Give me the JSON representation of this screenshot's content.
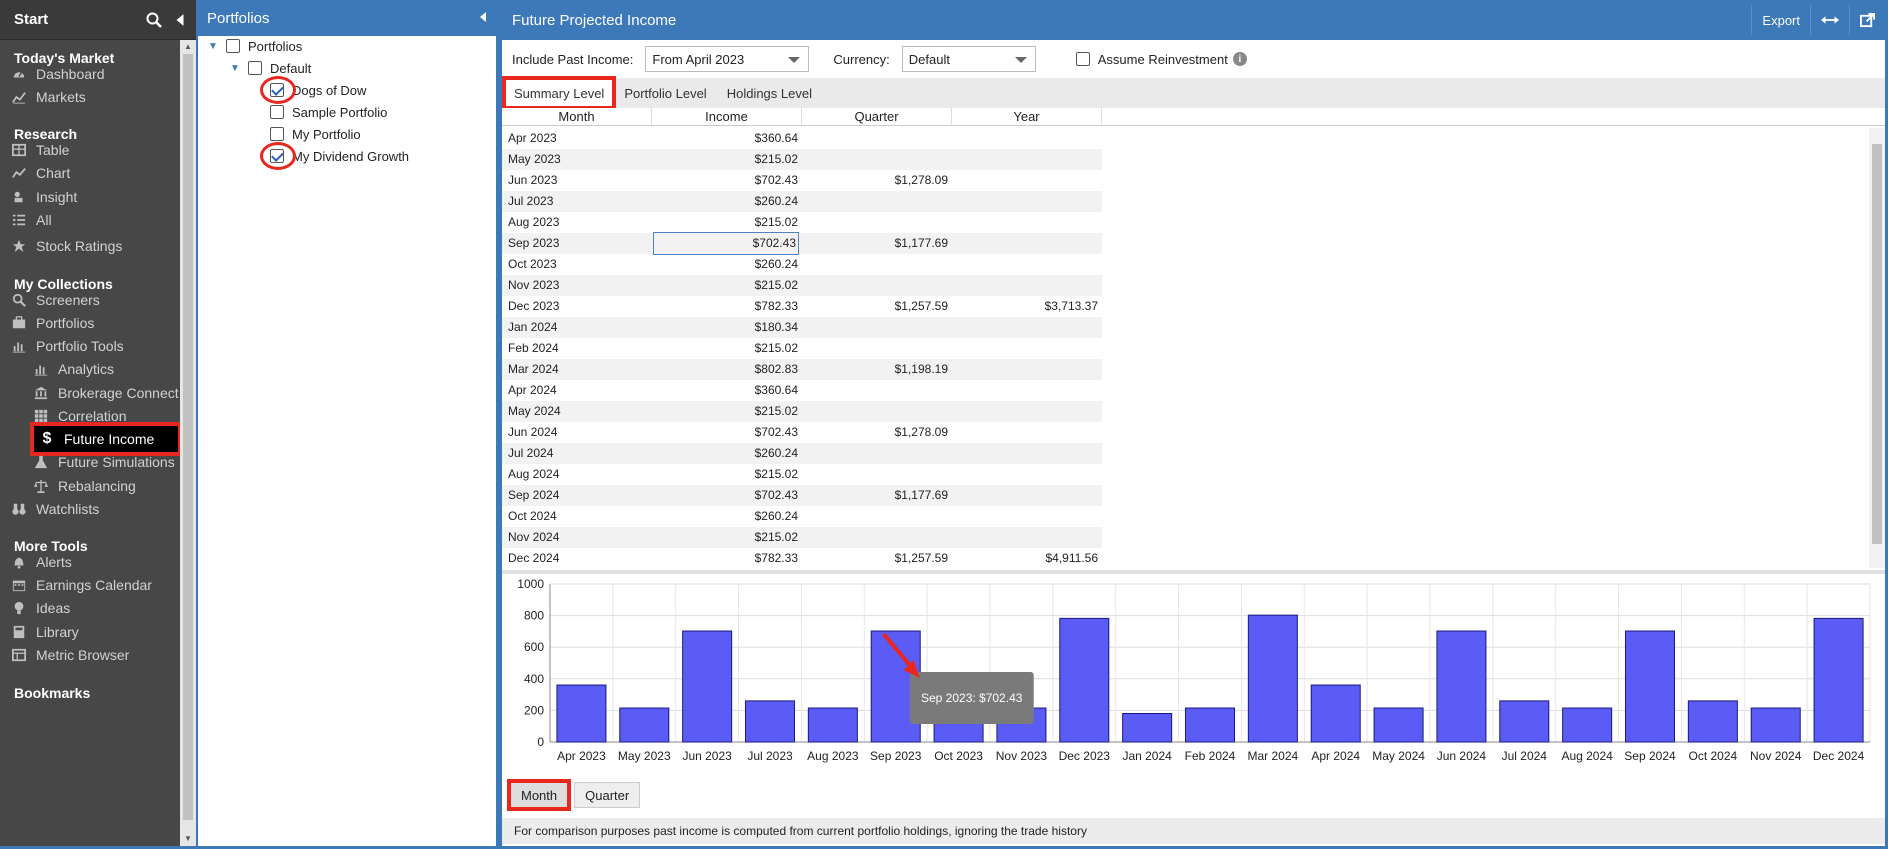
{
  "nav": {
    "title": "Start",
    "sections": [
      {
        "title": "Today's Market",
        "items": [
          {
            "label": "Dashboard",
            "icon": "dashboard-icon"
          },
          {
            "label": "Markets",
            "icon": "markets-icon"
          }
        ]
      },
      {
        "title": "Research",
        "items": [
          {
            "label": "Table",
            "icon": "table-icon"
          },
          {
            "label": "Chart",
            "icon": "chart-icon"
          },
          {
            "label": "Insight",
            "icon": "insight-icon"
          },
          {
            "label": "All",
            "icon": "list-icon"
          },
          {
            "label": "Stock Ratings",
            "icon": "star-icon"
          }
        ]
      },
      {
        "title": "My Collections",
        "items": [
          {
            "label": "Screeners",
            "icon": "search-icon"
          },
          {
            "label": "Portfolios",
            "icon": "briefcase-icon"
          },
          {
            "label": "Portfolio Tools",
            "icon": "bar-chart-icon"
          },
          {
            "label": "Analytics",
            "icon": "analytics-icon"
          },
          {
            "label": "Brokerage Connect",
            "icon": "bank-icon"
          },
          {
            "label": "Correlation",
            "icon": "grid-icon"
          },
          {
            "label": "Future Income",
            "icon": "dollar-icon"
          },
          {
            "label": "Future Simulations",
            "icon": "flask-icon"
          },
          {
            "label": "Rebalancing",
            "icon": "scale-icon"
          },
          {
            "label": "Watchlists",
            "icon": "binoculars-icon"
          }
        ]
      },
      {
        "title": "More Tools",
        "items": [
          {
            "label": "Alerts",
            "icon": "bell-icon"
          },
          {
            "label": "Earnings Calendar",
            "icon": "calendar-icon"
          },
          {
            "label": "Ideas",
            "icon": "bulb-icon"
          },
          {
            "label": "Library",
            "icon": "book-icon"
          },
          {
            "label": "Metric Browser",
            "icon": "browser-icon"
          }
        ]
      },
      {
        "title": "Bookmarks",
        "items": []
      }
    ]
  },
  "tree": {
    "title": "Portfolios",
    "nodes": [
      {
        "label": "Portfolios",
        "checked": false
      },
      {
        "label": "Default",
        "checked": false
      },
      {
        "label": "Dogs of Dow",
        "checked": true
      },
      {
        "label": "Sample Portfolio",
        "checked": false
      },
      {
        "label": "My Portfolio",
        "checked": false
      },
      {
        "label": "My Dividend Growth",
        "checked": true
      }
    ]
  },
  "main": {
    "title": "Future Projected Income",
    "export_label": "Export",
    "past_income_label": "Include Past Income:",
    "past_income_value": "From April 2023",
    "currency_label": "Currency:",
    "currency_value": "Default",
    "reinvest_label": "Assume Reinvestment",
    "tabs": [
      "Summary Level",
      "Portfolio Level",
      "Holdings Level"
    ],
    "columns": [
      "Month",
      "Income",
      "Quarter",
      "Year"
    ],
    "rows": [
      [
        "Apr 2023",
        "$360.64",
        "",
        ""
      ],
      [
        "May 2023",
        "$215.02",
        "",
        ""
      ],
      [
        "Jun 2023",
        "$702.43",
        "$1,278.09",
        ""
      ],
      [
        "Jul 2023",
        "$260.24",
        "",
        ""
      ],
      [
        "Aug 2023",
        "$215.02",
        "",
        ""
      ],
      [
        "Sep 2023",
        "$702.43",
        "$1,177.69",
        ""
      ],
      [
        "Oct 2023",
        "$260.24",
        "",
        ""
      ],
      [
        "Nov 2023",
        "$215.02",
        "",
        ""
      ],
      [
        "Dec 2023",
        "$782.33",
        "$1,257.59",
        "$3,713.37"
      ],
      [
        "Jan 2024",
        "$180.34",
        "",
        ""
      ],
      [
        "Feb 2024",
        "$215.02",
        "",
        ""
      ],
      [
        "Mar 2024",
        "$802.83",
        "$1,198.19",
        ""
      ],
      [
        "Apr 2024",
        "$360.64",
        "",
        ""
      ],
      [
        "May 2024",
        "$215.02",
        "",
        ""
      ],
      [
        "Jun 2024",
        "$702.43",
        "$1,278.09",
        ""
      ],
      [
        "Jul 2024",
        "$260.24",
        "",
        ""
      ],
      [
        "Aug 2024",
        "$215.02",
        "",
        ""
      ],
      [
        "Sep 2024",
        "$702.43",
        "$1,177.69",
        ""
      ],
      [
        "Oct 2024",
        "$260.24",
        "",
        ""
      ],
      [
        "Nov 2024",
        "$215.02",
        "",
        ""
      ],
      [
        "Dec 2024",
        "$782.33",
        "$1,257.59",
        "$4,911.56"
      ]
    ],
    "period_buttons": [
      "Month",
      "Quarter"
    ],
    "footer": "For comparison purposes past income is computed from current portfolio holdings, ignoring the trade history",
    "tooltip": "Sep 2023: $702.43"
  },
  "chart_data": {
    "type": "bar",
    "categories": [
      "Apr 2023",
      "May 2023",
      "Jun 2023",
      "Jul 2023",
      "Aug 2023",
      "Sep 2023",
      "Oct 2023",
      "Nov 2023",
      "Dec 2023",
      "Jan 2024",
      "Feb 2024",
      "Mar 2024",
      "Apr 2024",
      "May 2024",
      "Jun 2024",
      "Jul 2024",
      "Aug 2024",
      "Sep 2024",
      "Oct 2024",
      "Nov 2024",
      "Dec 2024"
    ],
    "values": [
      360.64,
      215.02,
      702.43,
      260.24,
      215.02,
      702.43,
      260.24,
      215.02,
      782.33,
      180.34,
      215.02,
      802.83,
      360.64,
      215.02,
      702.43,
      260.24,
      215.02,
      702.43,
      260.24,
      215.02,
      782.33
    ],
    "yticks": [
      "0",
      "200",
      "400",
      "600",
      "800",
      "1000"
    ],
    "ylim": [
      0,
      1000
    ],
    "bar_color": "#5b5bf5",
    "grid": true
  },
  "colors": {
    "accent": "#3d79b8",
    "highlight": "#e8281c"
  }
}
